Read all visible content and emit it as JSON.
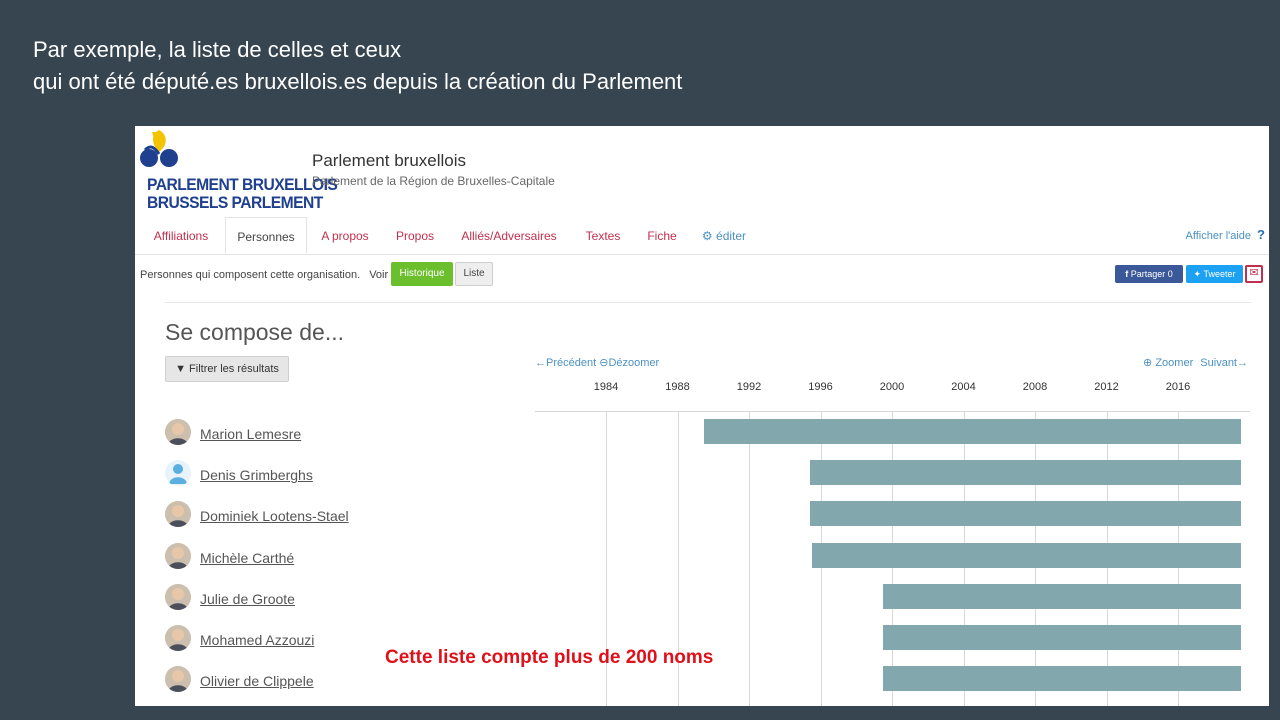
{
  "slide": {
    "line1": "Par exemple, la liste de celles et ceux",
    "line2": "qui ont été député.es bruxellois.es depuis la création du Parlement"
  },
  "header": {
    "logo_line1": "PARLEMENT BRUXELLOIS",
    "logo_line2": "BRUSSELS PARLEMENT",
    "title": "Parlement bruxellois",
    "subtitle": "Parlement de la Région de Bruxelles-Capitale"
  },
  "tabs": [
    {
      "label": "Affiliations",
      "active": false
    },
    {
      "label": "Personnes",
      "active": true
    },
    {
      "label": "A propos",
      "active": false
    },
    {
      "label": "Propos",
      "active": false
    },
    {
      "label": "Alliés/Adversaires",
      "active": false
    },
    {
      "label": "Textes",
      "active": false
    },
    {
      "label": "Fiche",
      "active": false
    }
  ],
  "edit_label": "éditer",
  "help_label": "Afficher l'aide",
  "help_icon": "?",
  "subbar": {
    "text": "Personnes qui composent cette organisation.",
    "voir": "Voir",
    "historique": "Historique",
    "liste": "Liste"
  },
  "share": {
    "facebook": "Partager 0",
    "twitter": "Tweeter"
  },
  "section_title": "Se compose de...",
  "filter_label": "Filtrer les résultats",
  "timeline": {
    "prev": "Précédent",
    "dezoom": "Dézoomer",
    "zoom": "Zoomer",
    "next": "Suivant",
    "years": [
      "1984",
      "1988",
      "1992",
      "1996",
      "2000",
      "2004",
      "2008",
      "2012",
      "2016"
    ]
  },
  "people": [
    {
      "name": "Marion Lemesre",
      "start": 1989.5,
      "end": 2019.5,
      "avatar": "person-photo"
    },
    {
      "name": "Denis Grimberghs",
      "start": 1995.4,
      "end": 2019.5,
      "avatar": "default-user-icon"
    },
    {
      "name": "Dominiek Lootens-Stael",
      "start": 1995.4,
      "end": 2019.5,
      "avatar": "person-photo"
    },
    {
      "name": "Michèle Carthé",
      "start": 1995.5,
      "end": 2019.5,
      "avatar": "person-photo"
    },
    {
      "name": "Julie de Groote",
      "start": 1999.5,
      "end": 2019.5,
      "avatar": "person-photo"
    },
    {
      "name": "Mohamed Azzouzi",
      "start": 1999.5,
      "end": 2019.5,
      "avatar": "person-photo"
    },
    {
      "name": "Olivier de Clippele",
      "start": 1999.5,
      "end": 2019.5,
      "avatar": "person-photo"
    }
  ],
  "note": "Cette liste compte plus de 200 noms",
  "colors": {
    "background": "#36454f",
    "tab_link": "#c0304e",
    "bar": "#82a7ad",
    "note": "#e0101a",
    "historique_button": "#6cbf2c"
  }
}
